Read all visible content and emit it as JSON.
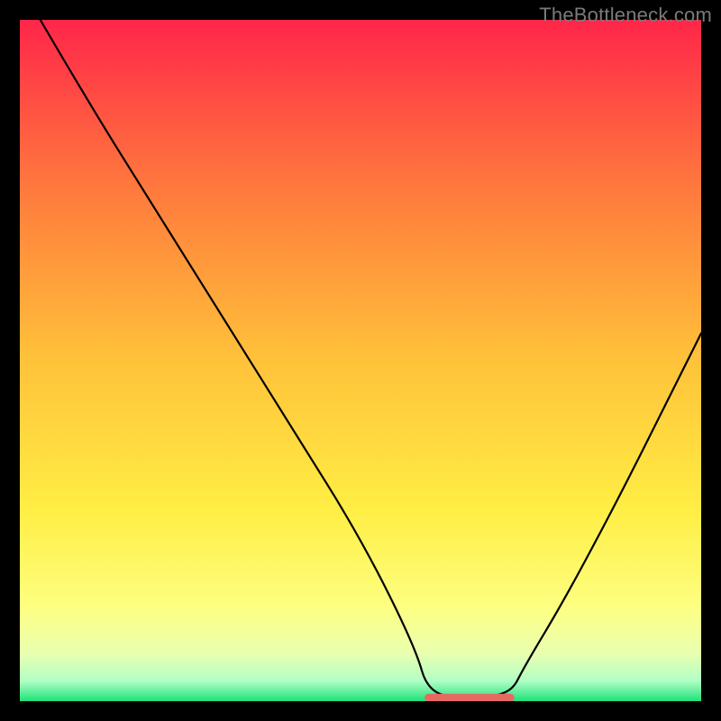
{
  "watermark": "TheBottleneck.com",
  "colors": {
    "page_bg": "#000000",
    "curve_stroke": "#000000",
    "flat_segment_stroke": "#e46a63",
    "gradient_stops": [
      {
        "offset": "0%",
        "color": "#ff2649"
      },
      {
        "offset": "25%",
        "color": "#ff7a3d"
      },
      {
        "offset": "50%",
        "color": "#ffc23a"
      },
      {
        "offset": "72%",
        "color": "#ffee44"
      },
      {
        "offset": "86%",
        "color": "#fdff80"
      },
      {
        "offset": "93%",
        "color": "#e9ffb0"
      },
      {
        "offset": "97%",
        "color": "#b2ffc4"
      },
      {
        "offset": "100%",
        "color": "#1ee27a"
      }
    ]
  },
  "chart_data": {
    "type": "line",
    "title": "",
    "xlabel": "",
    "ylabel": "",
    "x_range": [
      0,
      100
    ],
    "y_range": [
      0,
      100
    ],
    "optimal_range_x": [
      60,
      72
    ],
    "series": [
      {
        "name": "bottleneck-curve",
        "x": [
          3,
          10,
          20,
          30,
          40,
          50,
          58,
          60,
          66,
          72,
          74,
          80,
          88,
          96,
          100
        ],
        "y": [
          100,
          88,
          72,
          56,
          40,
          24,
          8,
          1,
          0.5,
          1,
          5,
          15,
          30,
          46,
          54
        ]
      }
    ]
  }
}
